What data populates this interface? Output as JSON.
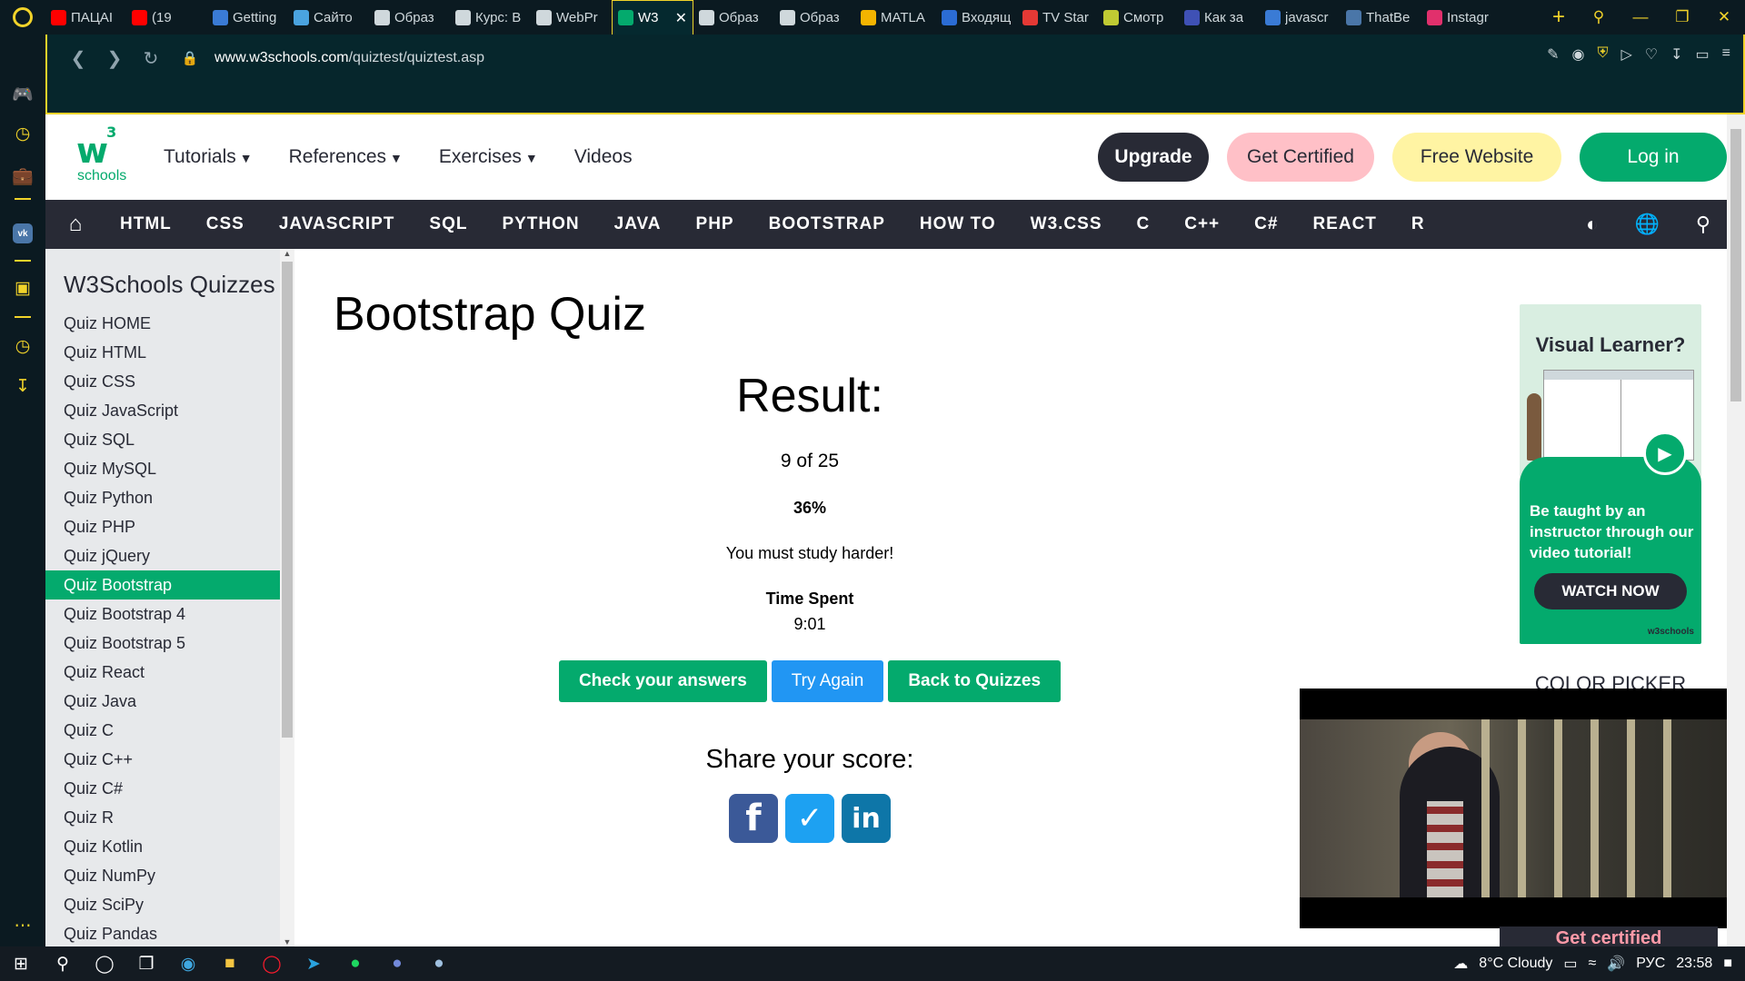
{
  "browser": {
    "tabs": [
      {
        "label": "ПАЦАІ",
        "icon": "youtube-icon",
        "color": "#ff0000"
      },
      {
        "label": "(19",
        "icon": "youtube-icon",
        "color": "#ff0000"
      },
      {
        "label": "Getting",
        "icon": "flag-icon",
        "color": "#3a7bd5"
      },
      {
        "label": "Сайто",
        "icon": "feather-icon",
        "color": "#4aa3df"
      },
      {
        "label": "Образ",
        "icon": "document-icon",
        "color": "#cfd8dc"
      },
      {
        "label": "Курс: В",
        "icon": "pen-icon",
        "color": "#cfd8dc"
      },
      {
        "label": "WebPr",
        "icon": "pen-icon",
        "color": "#cfd8dc"
      },
      {
        "label": "W3",
        "icon": "w3-icon",
        "color": "#04aa6d",
        "active": true
      },
      {
        "label": "Образ",
        "icon": "pen-icon",
        "color": "#cfd8dc"
      },
      {
        "label": "Образ",
        "icon": "pen-icon",
        "color": "#cfd8dc"
      },
      {
        "label": "MATLA",
        "icon": "drive-icon",
        "color": "#f4b400"
      },
      {
        "label": "Входящ",
        "icon": "mail-icon",
        "color": "#2b6cd4"
      },
      {
        "label": "TV Star",
        "icon": "tv-icon",
        "color": "#e53935"
      },
      {
        "label": "Смотр",
        "icon": "film-icon",
        "color": "#c0ca33"
      },
      {
        "label": "Как за",
        "icon": "s-icon",
        "color": "#3f51b5"
      },
      {
        "label": "javascr",
        "icon": "stack-icon",
        "color": "#3a7bd5"
      },
      {
        "label": "ThatBe",
        "icon": "vk-icon",
        "color": "#4a76a8"
      },
      {
        "label": "Instagr",
        "icon": "instagram-icon",
        "color": "#e1306c"
      }
    ],
    "url_host": "www.w3schools.com",
    "url_path": "/quiztest/quiztest.asp"
  },
  "site": {
    "logo_text": "schools",
    "menu": [
      "Tutorials",
      "References",
      "Exercises",
      "Videos"
    ],
    "buttons": {
      "upgrade": "Upgrade",
      "certified": "Get Certified",
      "free": "Free Website",
      "login": "Log in"
    },
    "subnav": [
      "HTML",
      "CSS",
      "JAVASCRIPT",
      "SQL",
      "PYTHON",
      "JAVA",
      "PHP",
      "BOOTSTRAP",
      "HOW TO",
      "W3.CSS",
      "C",
      "C++",
      "C#",
      "REACT",
      "R"
    ]
  },
  "sidebar": {
    "title": "W3Schools Quizzes",
    "items": [
      "Quiz HOME",
      "Quiz HTML",
      "Quiz CSS",
      "Quiz JavaScript",
      "Quiz SQL",
      "Quiz MySQL",
      "Quiz Python",
      "Quiz PHP",
      "Quiz jQuery",
      "Quiz Bootstrap",
      "Quiz Bootstrap 4",
      "Quiz Bootstrap 5",
      "Quiz React",
      "Quiz Java",
      "Quiz C",
      "Quiz C++",
      "Quiz C#",
      "Quiz R",
      "Quiz Kotlin",
      "Quiz NumPy",
      "Quiz SciPy",
      "Quiz Pandas"
    ],
    "active_index": 9
  },
  "main": {
    "title": "Bootstrap Quiz",
    "result_title": "Result:",
    "score": "9 of 25",
    "percent": "36%",
    "message": "You must study harder!",
    "time_label": "Time Spent",
    "time_value": "9:01",
    "btn_check": "Check your answers",
    "btn_try": "Try Again",
    "btn_back": "Back to Quizzes",
    "share": "Share your score:"
  },
  "ad": {
    "title": "Visual Learner?",
    "desc": "Be taught by an instructor through our video tutorial!",
    "cta": "WATCH NOW",
    "brand": "w3schools"
  },
  "colorpicker": "COLOR PICKER",
  "getcert": "Get certified",
  "taskbar": {
    "weather": "8°C Cloudy",
    "lang": "РУС",
    "clock": "23:58"
  }
}
